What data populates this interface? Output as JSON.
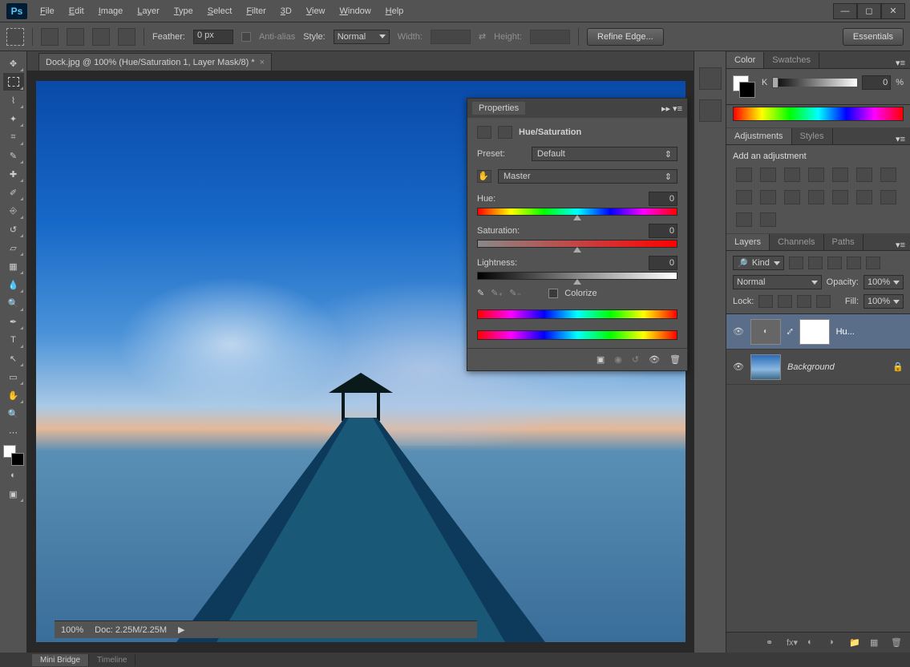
{
  "app": {
    "name": "Ps"
  },
  "menu": [
    "File",
    "Edit",
    "Image",
    "Layer",
    "Type",
    "Select",
    "Filter",
    "3D",
    "View",
    "Window",
    "Help"
  ],
  "options": {
    "feather_label": "Feather:",
    "feather_value": "0 px",
    "antialias_label": "Anti-alias",
    "style_label": "Style:",
    "style_value": "Normal",
    "width_label": "Width:",
    "height_label": "Height:",
    "refine_label": "Refine Edge...",
    "essentials_label": "Essentials"
  },
  "doc_tab": "Dock.jpg @ 100% (Hue/Saturation 1, Layer Mask/8) *",
  "right_icons": [
    "history",
    "properties"
  ],
  "panels": {
    "color": {
      "tab": "Color",
      "tab2": "Swatches",
      "label": "K",
      "value": "0",
      "unit": "%"
    },
    "adjustments": {
      "tab": "Adjustments",
      "tab2": "Styles",
      "title": "Add an adjustment"
    },
    "layers": {
      "tab": "Layers",
      "tab2": "Channels",
      "tab3": "Paths",
      "kind": "Kind",
      "blend": "Normal",
      "opacity_label": "Opacity:",
      "opacity": "100%",
      "lock_label": "Lock:",
      "fill_label": "Fill:",
      "fill": "100%",
      "layer1": "Hu...",
      "layer2": "Background"
    }
  },
  "props": {
    "title": "Properties",
    "heading": "Hue/Saturation",
    "preset_label": "Preset:",
    "preset_value": "Default",
    "channel_value": "Master",
    "hue_label": "Hue:",
    "hue_value": "0",
    "sat_label": "Saturation:",
    "sat_value": "0",
    "light_label": "Lightness:",
    "light_value": "0",
    "colorize_label": "Colorize"
  },
  "status": {
    "zoom": "100%",
    "doc": "Doc: 2.25M/2.25M"
  },
  "bottom_tabs": [
    "Mini Bridge",
    "Timeline"
  ]
}
